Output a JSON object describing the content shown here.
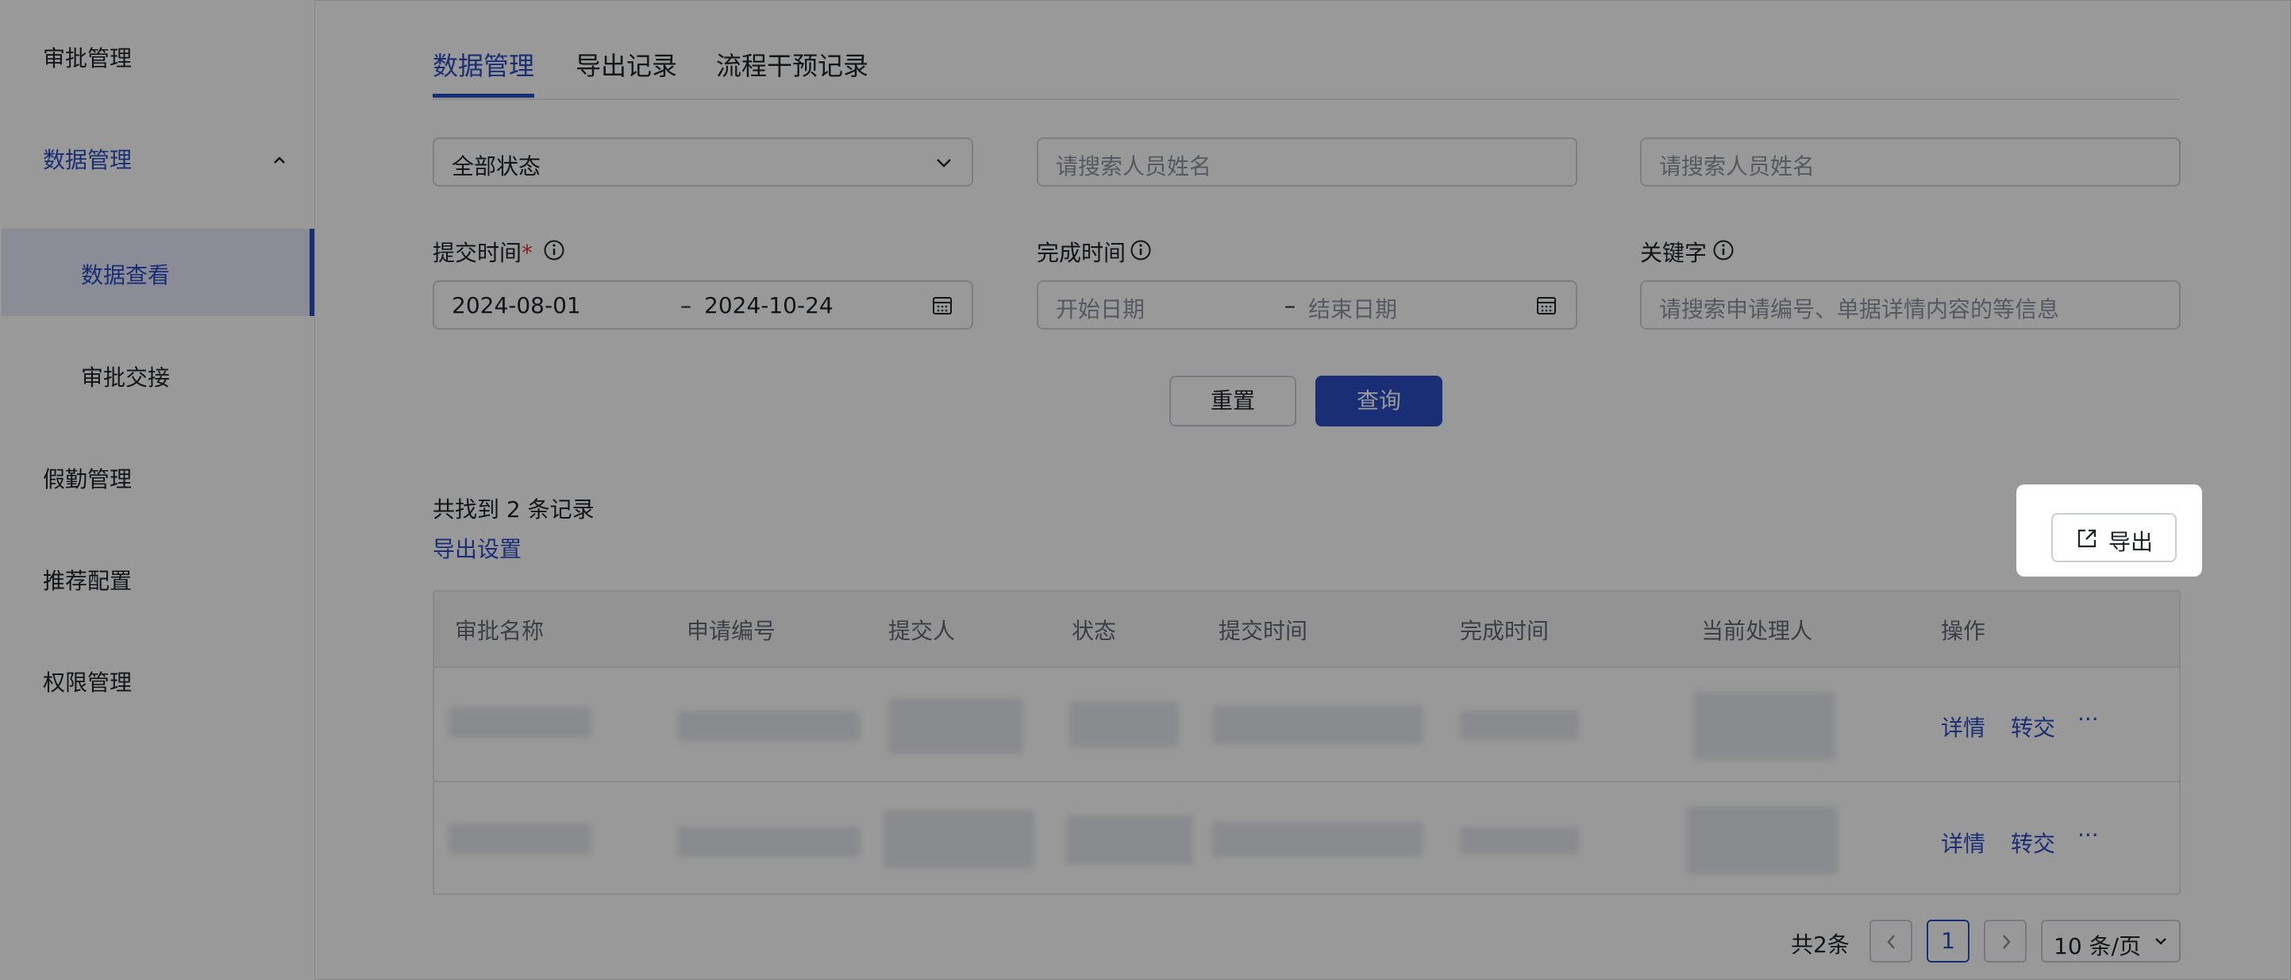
{
  "sidebar": {
    "items": [
      {
        "label": "审批管理"
      },
      {
        "label": "数据管理"
      },
      {
        "label": "数据查看"
      },
      {
        "label": "审批交接"
      },
      {
        "label": "假勤管理"
      },
      {
        "label": "推荐配置"
      },
      {
        "label": "权限管理"
      }
    ]
  },
  "tabs": [
    {
      "label": "数据管理"
    },
    {
      "label": "导出记录"
    },
    {
      "label": "流程干预记录"
    }
  ],
  "filters": {
    "status": {
      "value": "全部状态"
    },
    "name_search_1": {
      "placeholder": "请搜索人员姓名"
    },
    "name_search_2": {
      "placeholder": "请搜索人员姓名"
    },
    "submit_time": {
      "label": "提交时间",
      "required_mark": "*",
      "start": "2024-08-01",
      "separator": "–",
      "end": "2024-10-24"
    },
    "complete_time": {
      "label": "完成时间",
      "start_placeholder": "开始日期",
      "separator": "–",
      "end_placeholder": "结束日期"
    },
    "keyword": {
      "label": "关键字",
      "placeholder": "请搜索申请编号、单据详情内容的等信息"
    }
  },
  "buttons": {
    "reset": "重置",
    "query": "查询",
    "export": "导出"
  },
  "results": {
    "count_text": "共找到 2 条记录",
    "export_settings": "导出设置"
  },
  "table": {
    "columns": [
      "审批名称",
      "申请编号",
      "提交人",
      "状态",
      "提交时间",
      "完成时间",
      "当前处理人",
      "操作"
    ],
    "rows": [
      {
        "actions": {
          "detail": "详情",
          "transfer": "转交",
          "more": "···"
        }
      },
      {
        "actions": {
          "detail": "详情",
          "transfer": "转交",
          "more": "···"
        }
      }
    ]
  },
  "pagination": {
    "total": "共2条",
    "current": "1",
    "page_size": "10 条/页"
  },
  "colors": {
    "accent": "#2a4ec4",
    "overlay": "rgba(0,0,0,0.4)"
  }
}
